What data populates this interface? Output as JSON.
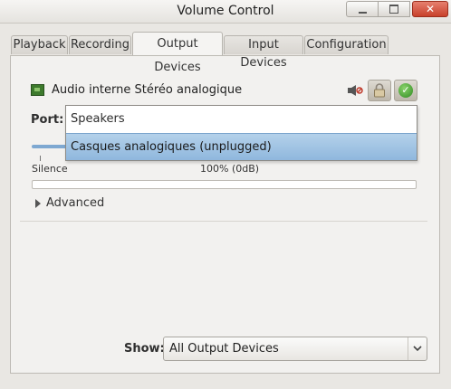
{
  "window": {
    "title": "Volume Control"
  },
  "window_controls": {
    "minimize": "minimize",
    "maximize": "maximize",
    "close": "✕"
  },
  "tabs": [
    {
      "label": "Playback"
    },
    {
      "label": "Recording"
    },
    {
      "label": "Output Devices",
      "active": true
    },
    {
      "label": "Input Devices"
    },
    {
      "label": "Configuration"
    }
  ],
  "device": {
    "name": "Audio interne Stéréo analogique",
    "icon": "sound-card-icon",
    "mute_icon": "mute-speaker-icon",
    "lock_icon": "lock-icon",
    "default_icon": "check-circle-icon"
  },
  "port": {
    "label": "Port:",
    "options": [
      "Speakers",
      "Casques analogiques (unplugged)"
    ],
    "highlighted_index": 1
  },
  "volume": {
    "silence_label": "Silence",
    "level_label": "100% (0dB)"
  },
  "advanced": {
    "label": "Advanced"
  },
  "show": {
    "label": "Show:",
    "value": "All Output Devices"
  },
  "colors": {
    "accent": "#8fb7dd",
    "close_button": "#c8412c",
    "check": "#2f8a20"
  }
}
